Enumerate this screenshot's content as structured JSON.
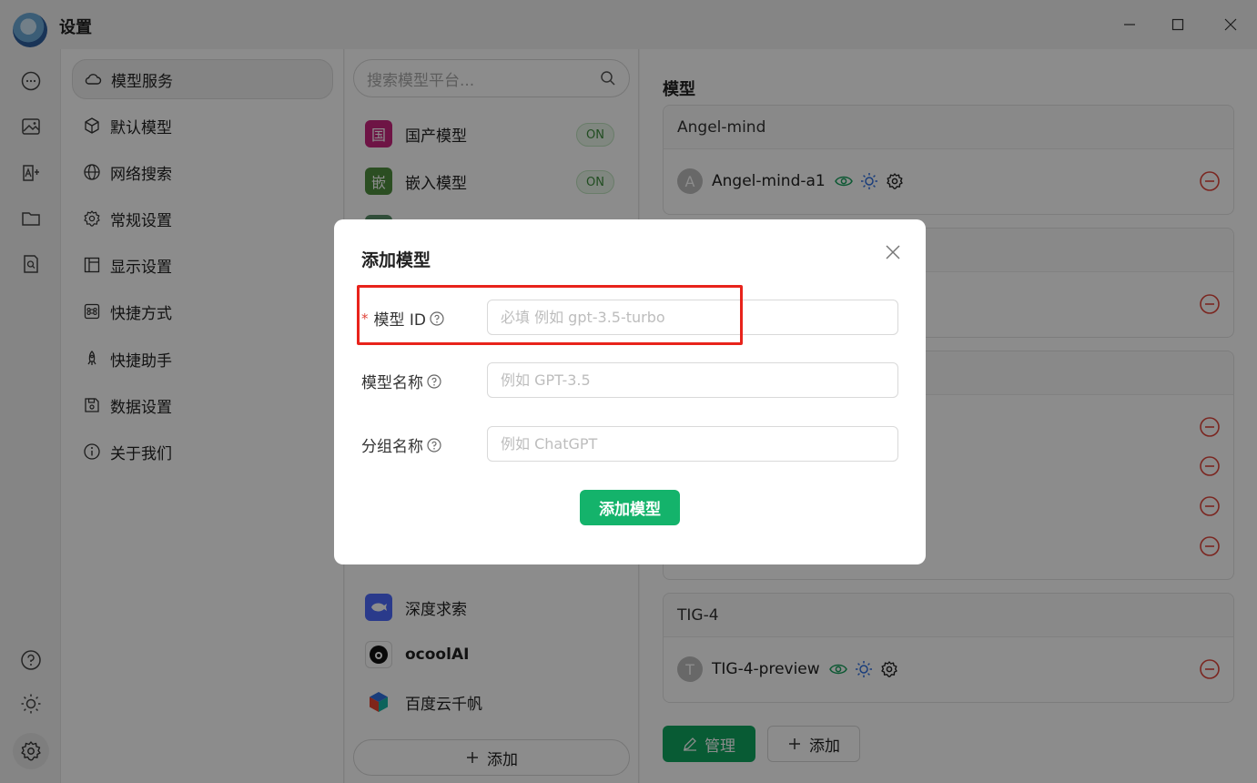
{
  "window": {
    "title": "设置",
    "controls": [
      "minimize",
      "maximize",
      "close"
    ]
  },
  "leftbar": {
    "top_icons": [
      "chat-icon",
      "image-icon",
      "translate-icon",
      "folder-icon",
      "document-search-icon"
    ],
    "bottom_icons": [
      "help-icon",
      "theme-icon",
      "settings-icon"
    ]
  },
  "settings_nav": {
    "items": [
      {
        "label": "模型服务",
        "icon": "cloud-icon",
        "active": true
      },
      {
        "label": "默认模型",
        "icon": "cube-icon"
      },
      {
        "label": "网络搜索",
        "icon": "globe-icon"
      },
      {
        "label": "常规设置",
        "icon": "gear-icon"
      },
      {
        "label": "显示设置",
        "icon": "layout-icon"
      },
      {
        "label": "快捷方式",
        "icon": "command-icon"
      },
      {
        "label": "快捷助手",
        "icon": "rocket-icon"
      },
      {
        "label": "数据设置",
        "icon": "save-icon"
      },
      {
        "label": "关于我们",
        "icon": "info-icon"
      }
    ]
  },
  "providers": {
    "search_placeholder": "搜索模型平台...",
    "items": [
      {
        "label": "国产模型",
        "logo_text": "国",
        "logo_color": "#c8267e",
        "toggle": "ON"
      },
      {
        "label": "嵌入模型",
        "logo_text": "嵌",
        "logo_color": "#4f8f3f",
        "toggle": "ON"
      },
      {
        "label": "深度求索",
        "logo_color": "#4d6bfe"
      },
      {
        "label": "ocoolAI",
        "logo_color": "#111111"
      },
      {
        "label": "百度云千帆",
        "logo_color": "#2f6fe0"
      }
    ],
    "add_label": "添加"
  },
  "models": {
    "section_title": "模型",
    "groups": [
      {
        "name": "Angel-mind",
        "models": [
          {
            "avatar": "A",
            "name": "Angel-mind-a1"
          }
        ]
      },
      {
        "name": "TIG-4",
        "models": [
          {
            "avatar": "T",
            "name": "TIG-4-preview"
          }
        ]
      }
    ],
    "manage_label": "管理",
    "add_label": "添加"
  },
  "dialog": {
    "title": "添加模型",
    "fields": [
      {
        "label": "模型 ID",
        "required": true,
        "placeholder": "必填 例如 gpt-3.5-turbo"
      },
      {
        "label": "模型名称",
        "placeholder": "例如 GPT-3.5"
      },
      {
        "label": "分组名称",
        "placeholder": "例如 ChatGPT"
      }
    ],
    "submit_label": "添加模型"
  },
  "colors": {
    "accent": "#14b36b",
    "highlight": "#e8231b",
    "danger": "#e0453b"
  }
}
